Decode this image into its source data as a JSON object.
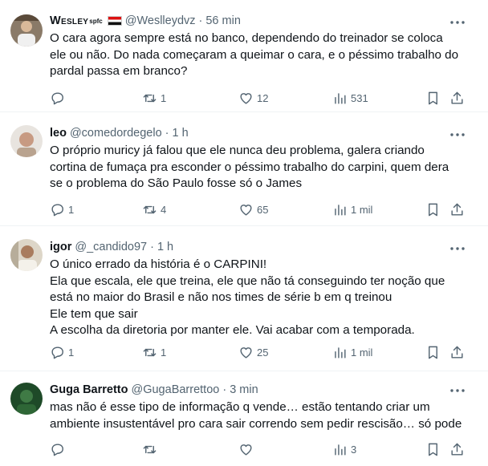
{
  "tweets": [
    {
      "name": "Wesley",
      "name_suffix": "spfc",
      "handle": "@Weslleydvz",
      "time": "56 min",
      "lines": [
        "O cara agora sempre está no banco, dependendo do treinador se coloca",
        "ele ou não. Do nada começaram a queimar o cara, e o péssimo trabalho do",
        "pardal passa em branco?"
      ],
      "replies": "",
      "retweets": "1",
      "likes": "12",
      "views": "531"
    },
    {
      "name": "leo",
      "handle": "@comedordegelo",
      "time": "1 h",
      "lines": [
        "O próprio muricy já falou que ele nunca deu problema, galera criando",
        "cortina de fumaça pra esconder o péssimo trabalho do carpini, quem dera",
        "se o problema do São Paulo fosse só o James"
      ],
      "replies": "1",
      "retweets": "4",
      "likes": "65",
      "views": "1 mil"
    },
    {
      "name": "igor",
      "handle": "@_candido97",
      "time": "1 h",
      "lines": [
        "O único errado da história é o CARPINI!",
        "Ela que escala, ele que treina, ele que não tá conseguindo ter noção que",
        "está no maior do Brasil e não nos times de série b em q treinou",
        "Ele tem que sair",
        "A escolha da diretoria por manter ele. Vai acabar com a temporada."
      ],
      "replies": "1",
      "retweets": "1",
      "likes": "25",
      "views": "1 mil"
    },
    {
      "name": "Guga Barretto",
      "handle": "@GugaBarrettoo",
      "time": "3 min",
      "lines": [
        "mas não é esse tipo de informação q vende… estão tentando criar um",
        "ambiente insustentável pro cara sair correndo sem pedir rescisão… só pode"
      ],
      "replies": "",
      "retweets": "",
      "likes": "",
      "views": "3"
    }
  ],
  "separator": "·",
  "colors": {
    "text": "#0f1419",
    "muted": "#536471",
    "border": "#eff3f4"
  }
}
